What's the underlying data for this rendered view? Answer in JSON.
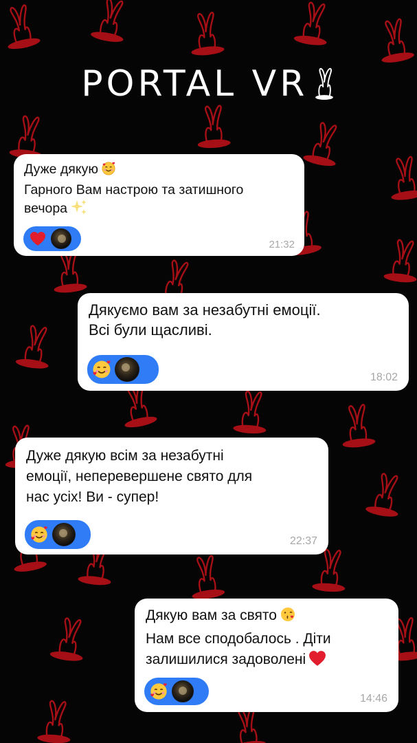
{
  "brand": {
    "logo_text": "PORTAL VR"
  },
  "messages": [
    {
      "lines": [
        "Дуже дякую",
        "Гарного Вам настрою та затишного",
        "вечора"
      ],
      "inline_emojis": [
        "smiling-face-with-hearts",
        "sparkles"
      ],
      "reactions": [
        "red-heart",
        "avatar"
      ],
      "time": "21:32",
      "side": "left"
    },
    {
      "lines": [
        "Дякуємо вам за незабутні емоції.",
        "Всі були щасливі."
      ],
      "reactions": [
        "smiling-face-with-hearts",
        "avatar"
      ],
      "time": "18:02",
      "side": "right"
    },
    {
      "lines": [
        "Дуже дякую всім за незабутні",
        "емоції, неперевершене свято для",
        "нас усіх! Ви - супер!"
      ],
      "reactions": [
        "smiling-face-with-hearts",
        "avatar"
      ],
      "time": "22:37",
      "side": "left"
    },
    {
      "lines": [
        "Дякую вам за свято",
        "Нам  все сподобалось . Діти",
        "залишилися задоволені"
      ],
      "inline_emojis": [
        "face-blowing-a-kiss",
        "red-heart"
      ],
      "reactions": [
        "smiling-face-with-hearts",
        "avatar"
      ],
      "time": "14:46",
      "side": "right"
    }
  ],
  "colors": {
    "background": "#050505",
    "bunny_pattern": "#c4121a",
    "bubble": "#ffffff",
    "reaction_pill": "#2f7cf6",
    "timestamp": "#a7a7a7"
  }
}
